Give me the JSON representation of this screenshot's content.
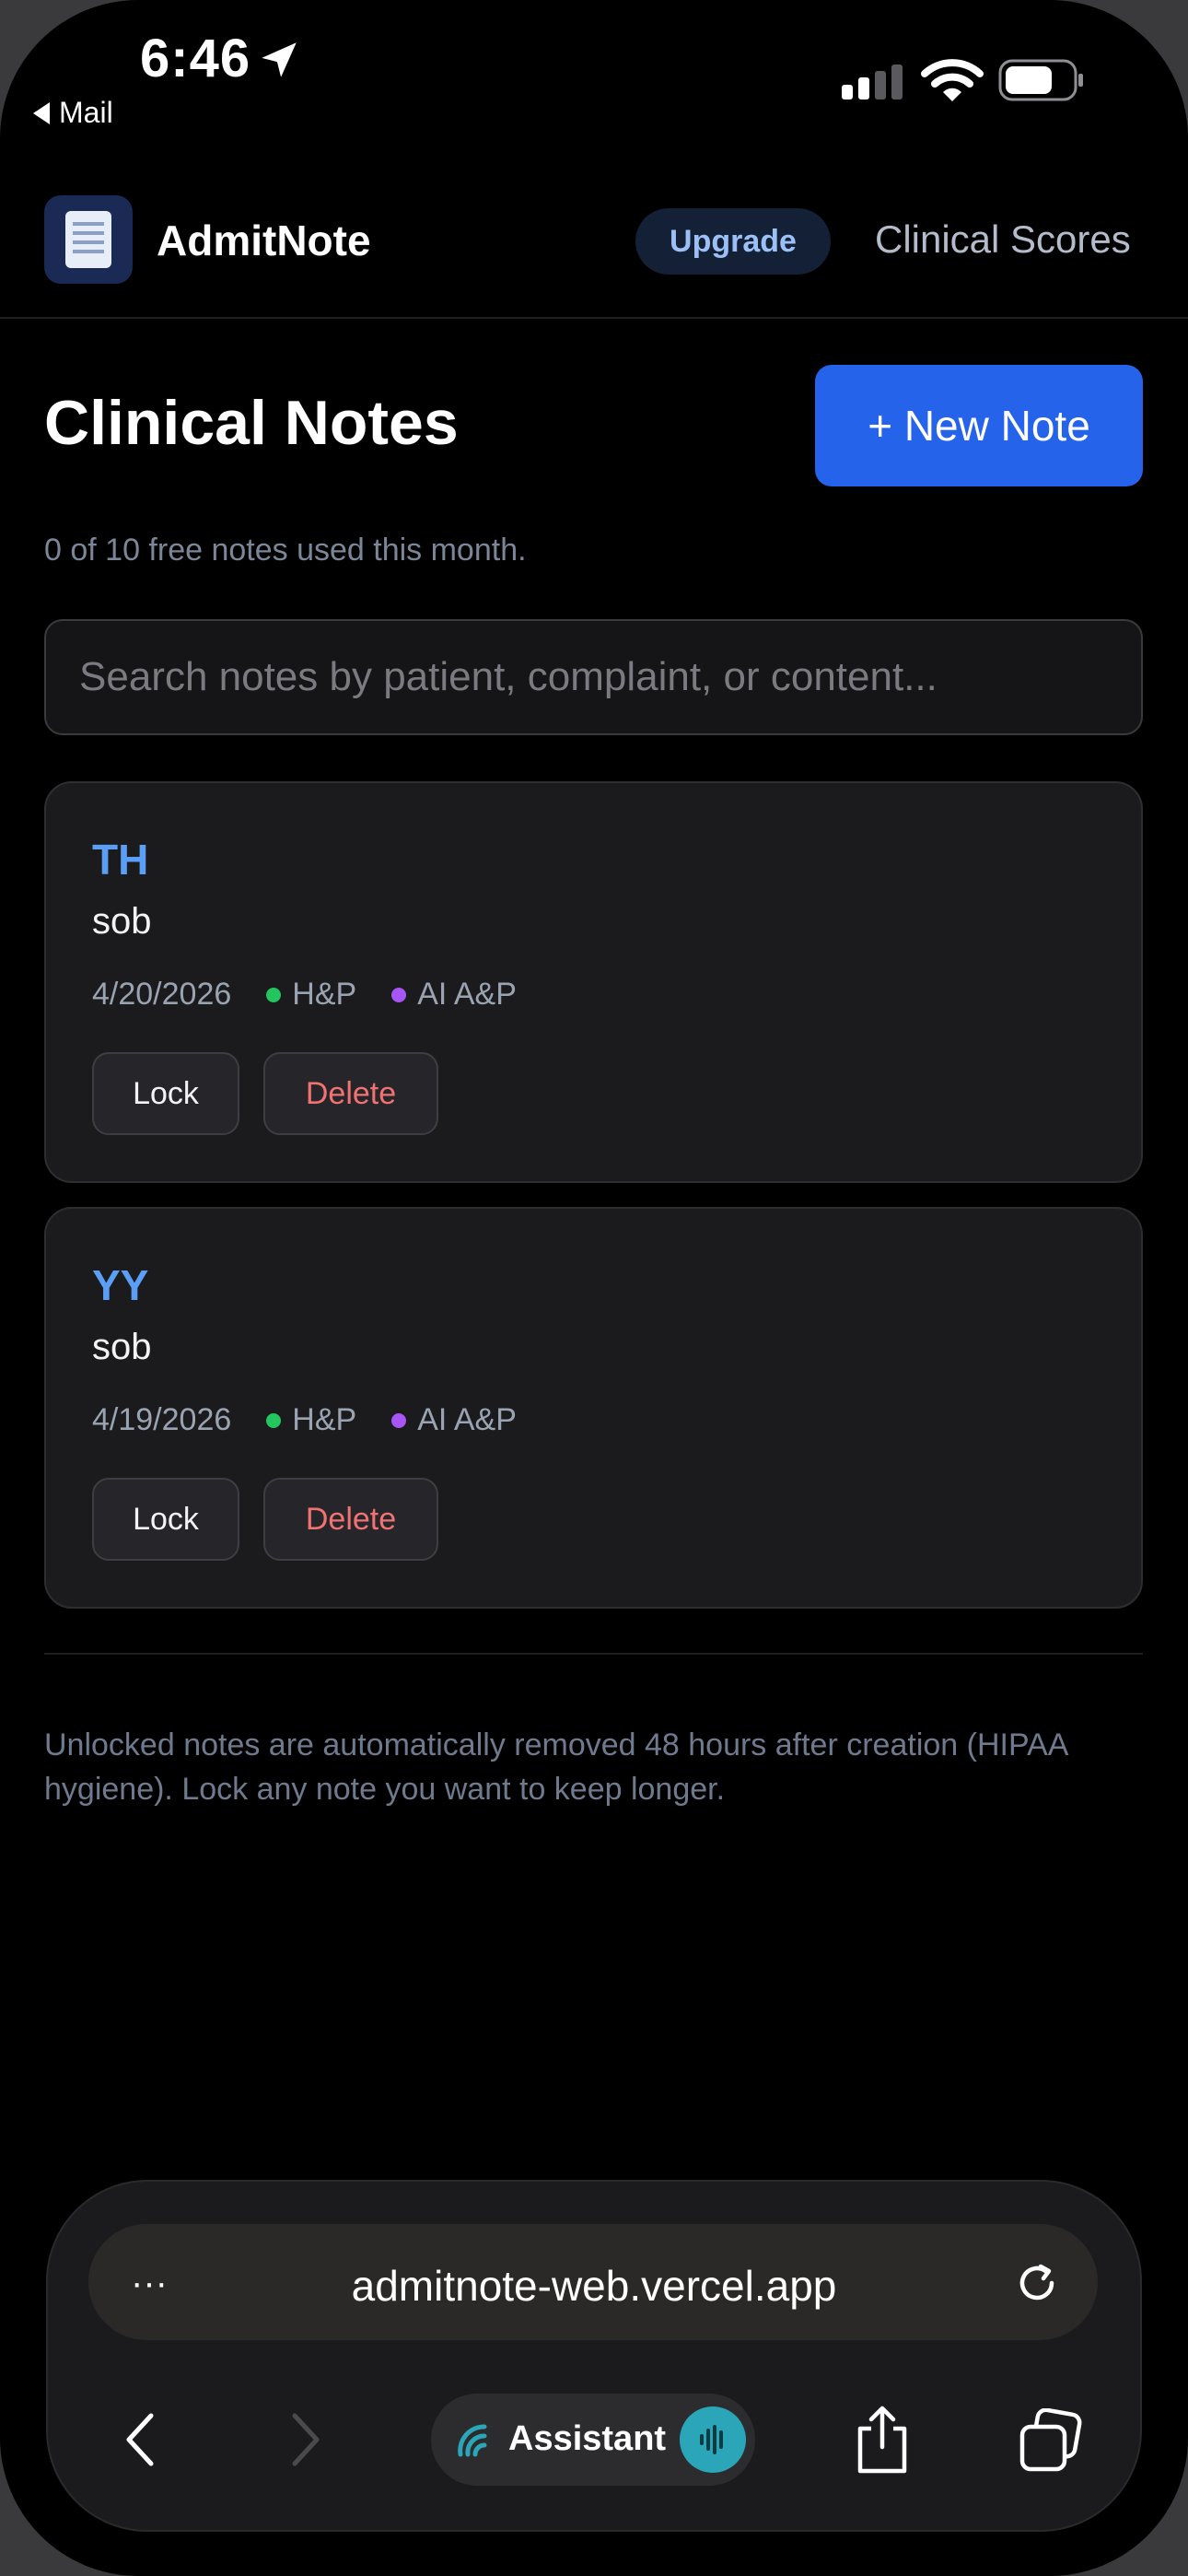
{
  "status_bar": {
    "time": "6:46",
    "back_label": "Mail"
  },
  "header": {
    "app_name": "AdmitNote",
    "upgrade_label": "Upgrade",
    "scores_label": "Clinical Scores"
  },
  "main": {
    "title": "Clinical Notes",
    "new_note_label": "+ New Note",
    "usage_text": "0 of 10 free notes used this month.",
    "search_placeholder": "Search notes by patient, complaint, or content...",
    "search_value": ""
  },
  "notes": [
    {
      "initials": "TH",
      "complaint": "sob",
      "date": "4/20/2026",
      "tag1": "H&P",
      "tag1_color": "#22c55e",
      "tag2": "AI A&P",
      "tag2_color": "#a855f7",
      "lock_label": "Lock",
      "delete_label": "Delete"
    },
    {
      "initials": "YY",
      "complaint": "sob",
      "date": "4/19/2026",
      "tag1": "H&P",
      "tag1_color": "#22c55e",
      "tag2": "AI A&P",
      "tag2_color": "#a855f7",
      "lock_label": "Lock",
      "delete_label": "Delete"
    }
  ],
  "footer": {
    "note": "Unlocked notes are automatically removed 48 hours after creation (HIPAA hygiene). Lock any note you want to keep longer."
  },
  "browser": {
    "url": "admitnote-web.vercel.app",
    "assistant_label": "Assistant",
    "more_glyph": "···"
  },
  "colors": {
    "accent": "#2563eb",
    "initials": "#5b9ef5",
    "delete": "#f07272",
    "background": "#000000"
  },
  "icons": [
    "location-arrow-icon",
    "signal-icon",
    "wifi-icon",
    "battery-icon",
    "app-logo-icon",
    "more-icon",
    "reload-icon",
    "back-icon",
    "forward-icon",
    "assistant-icon",
    "voice-icon",
    "share-icon",
    "tabs-icon"
  ]
}
